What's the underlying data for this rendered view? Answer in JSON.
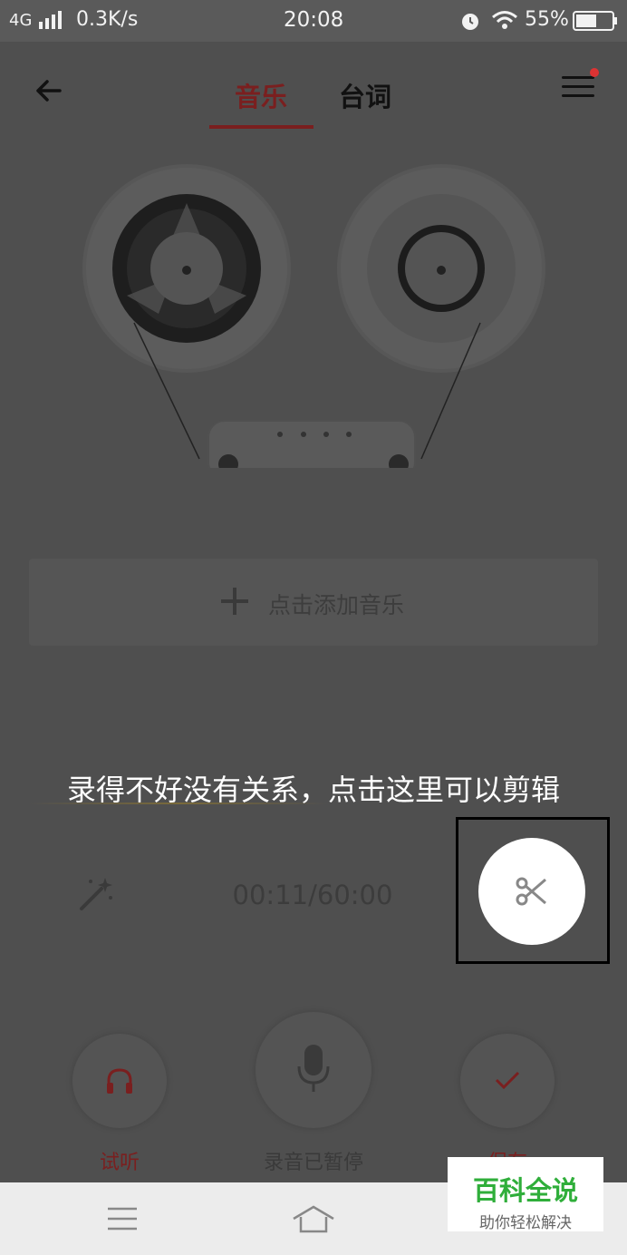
{
  "status_bar": {
    "network": "4G",
    "speed": "0.3K/s",
    "time": "20:08",
    "battery": "55%"
  },
  "tabs": [
    {
      "label": "音乐",
      "active": true
    },
    {
      "label": "台词",
      "active": false
    }
  ],
  "add_music": {
    "label": "点击添加音乐"
  },
  "tooltip": {
    "text": "录得不好没有关系，点击这里可以剪辑"
  },
  "recording": {
    "time": "00:11/60:00"
  },
  "controls": {
    "listen_label": "试听",
    "record_label": "录音已暂停",
    "save_label": "保存"
  },
  "watermark": {
    "title": "百科全说",
    "subtitle": "助你轻松解决"
  },
  "colors": {
    "accent": "#b03030",
    "overlay": "#4f4f4f",
    "watermark_green": "#2fae3a"
  }
}
